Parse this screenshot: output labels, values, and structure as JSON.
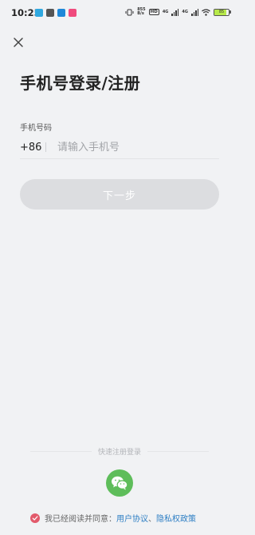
{
  "status_bar": {
    "time": "10:25",
    "net_speed_value": "855",
    "net_speed_unit": "B/s",
    "hd_label": "HD",
    "network_1": "4G",
    "network_2": "4G",
    "battery_text": "85",
    "battery_level": 0.85,
    "app_icon_colors": [
      "#2fa8e0",
      "#555555",
      "#1e88d8",
      "#f04b7d"
    ],
    "battery_color": "#b7e94a"
  },
  "header": {
    "close_icon": "close-icon",
    "title": "手机号登录/注册"
  },
  "form": {
    "phone_label": "手机号码",
    "country_code": "+86",
    "phone_placeholder": "请输入手机号",
    "phone_value": "",
    "next_label": "下一步"
  },
  "quick_login": {
    "label": "快速注册登录",
    "wechat_icon": "wechat-icon",
    "wechat_color": "#5ebd5a"
  },
  "agreement": {
    "prefix": "我已经阅读并同意：",
    "user_agreement": "用户协议",
    "separator": "、",
    "privacy_policy": "隐私权政策",
    "checked": true,
    "check_color": "#e25a6b",
    "link_color": "#2e7fc4"
  }
}
